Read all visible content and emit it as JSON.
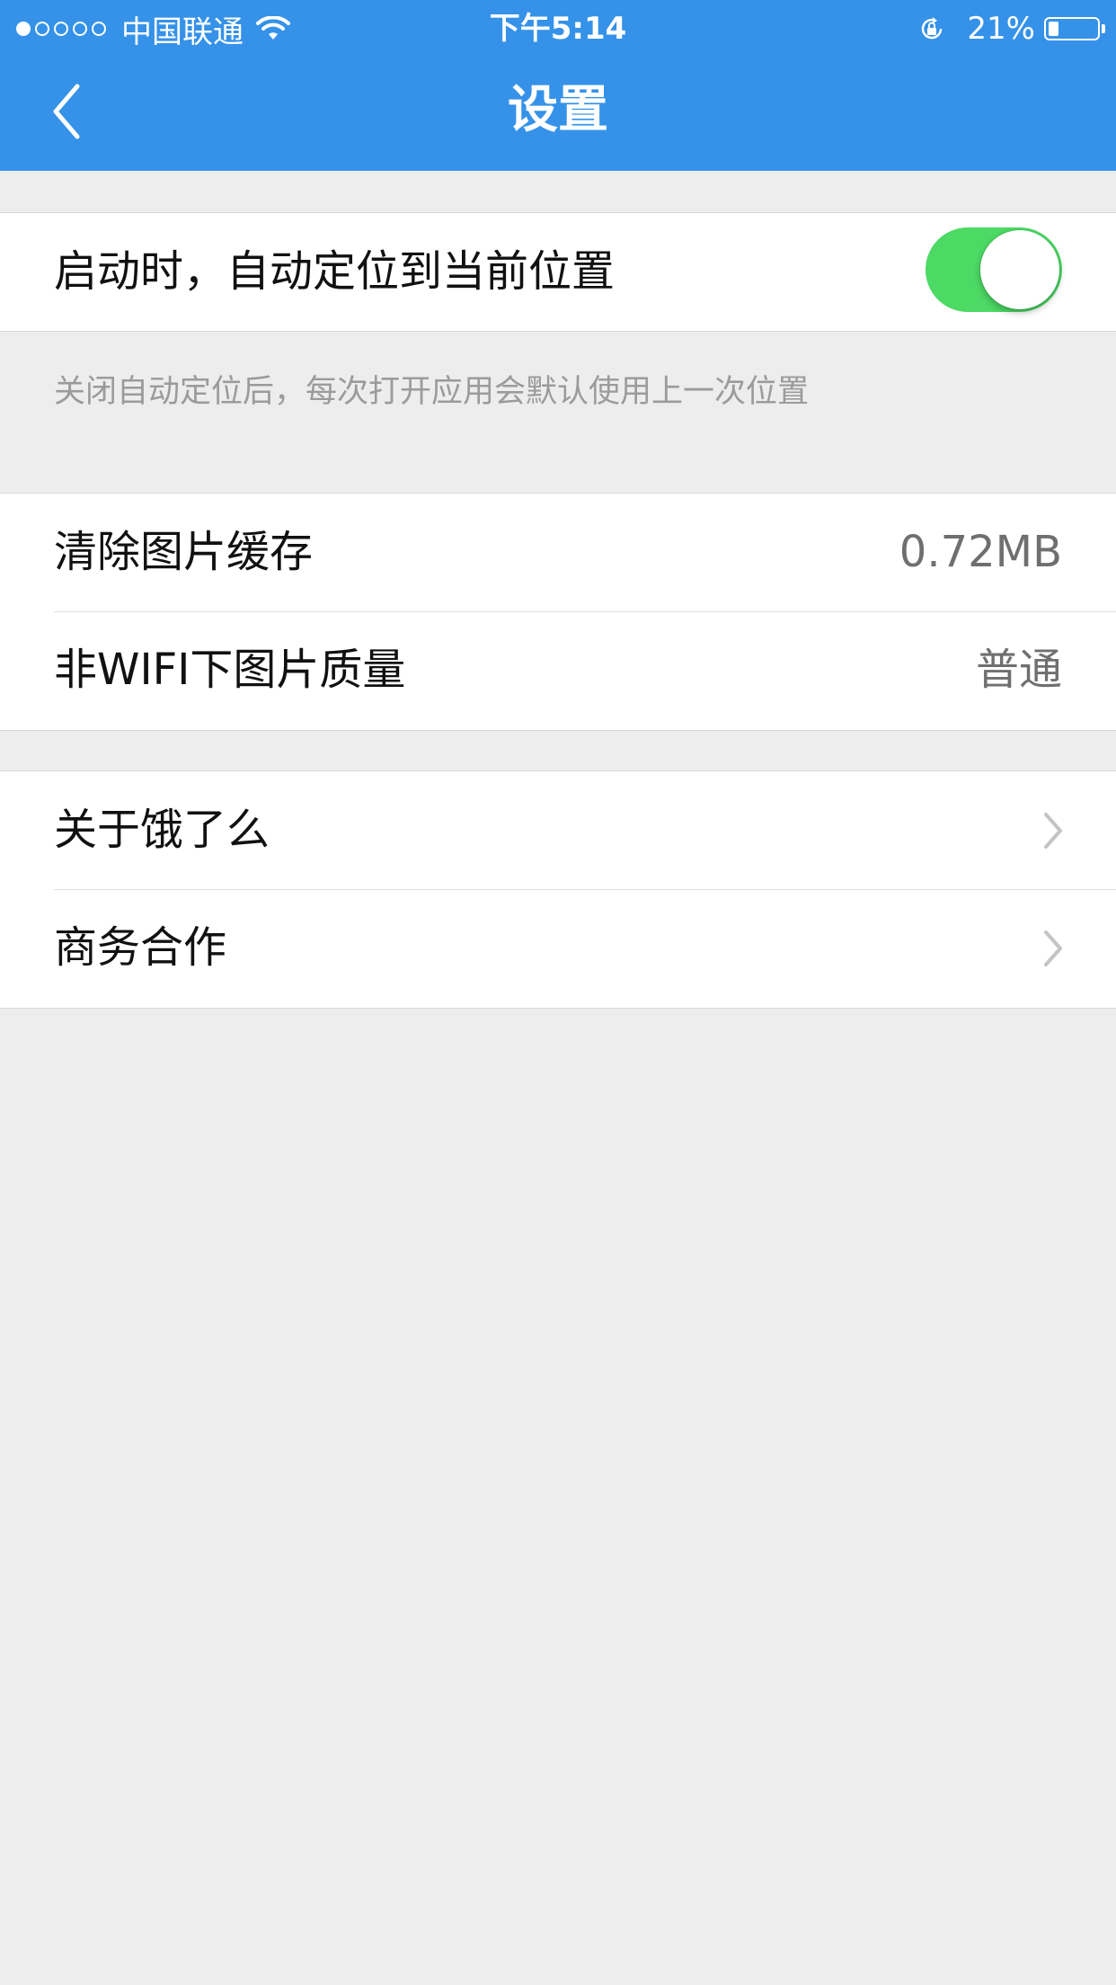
{
  "status_bar": {
    "signal_dots_filled": 1,
    "signal_dots_total": 5,
    "carrier": "中国联通",
    "wifi_icon": "wifi-icon",
    "time": "下午5:14",
    "rotation_lock_icon": "rotation-lock-icon",
    "battery_pct": "21%",
    "battery_level": 0.21,
    "color": "#ffffff"
  },
  "nav": {
    "back_icon": "chevron-left-icon",
    "title": "设置",
    "background": "#3592e8"
  },
  "location": {
    "label": "启动时，自动定位到当前位置",
    "toggle_on": true,
    "toggle_color": "#4cd964",
    "hint": "关闭自动定位后，每次打开应用会默认使用上一次位置"
  },
  "media": {
    "clear_cache_label": "清除图片缓存",
    "cache_size": "0.72MB",
    "image_quality_label": "非WIFI下图片质量",
    "image_quality_value": "普通"
  },
  "about": {
    "about_label": "关于饿了么",
    "business_label": "商务合作",
    "chevron_icon": "chevron-right-icon"
  }
}
